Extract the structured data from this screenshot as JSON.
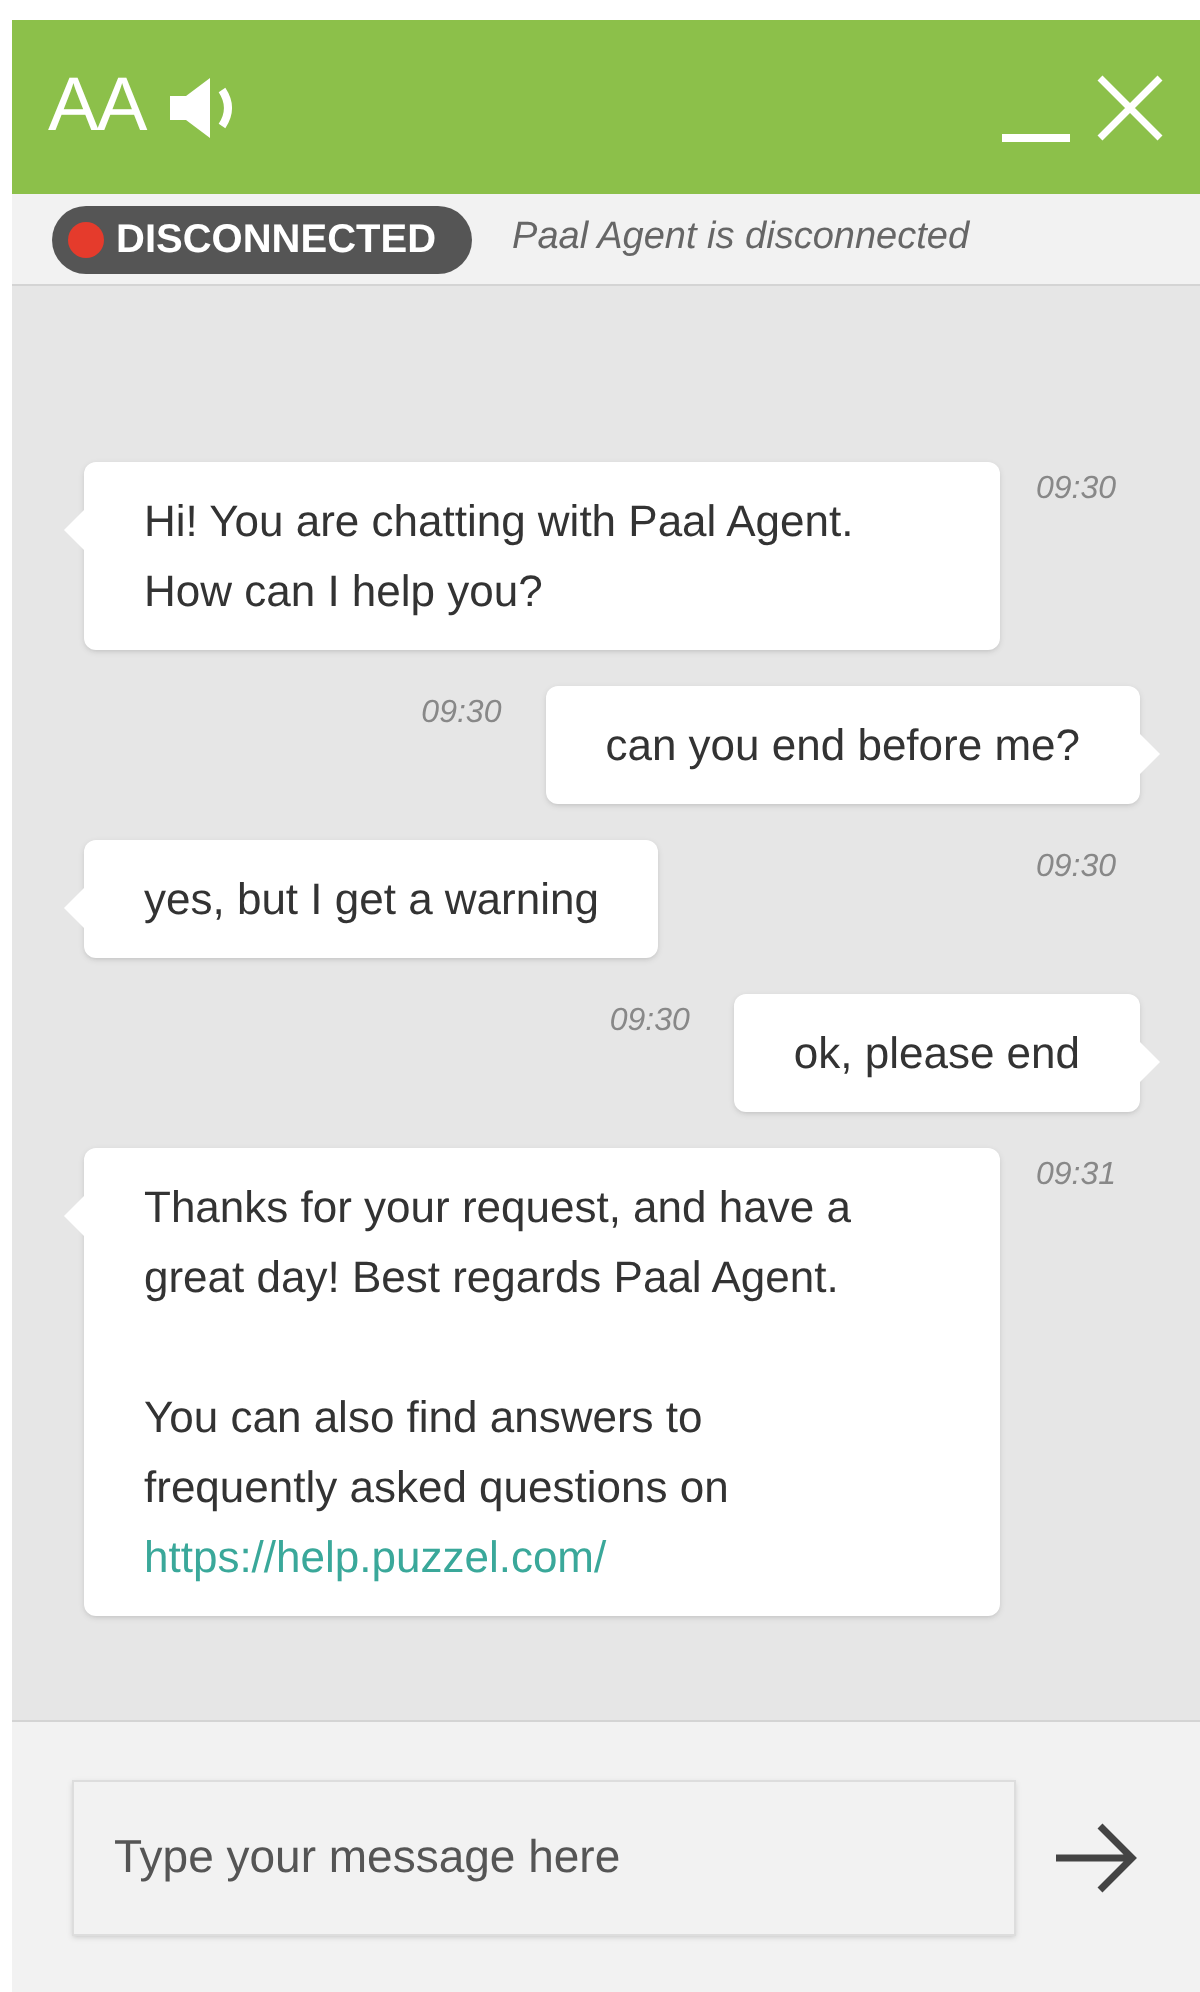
{
  "header": {
    "font_button": "AA"
  },
  "status": {
    "badge": "DISCONNECTED",
    "message": "Paal Agent is disconnected"
  },
  "messages": [
    {
      "kind": "agent",
      "time": "09:30",
      "paragraphs": [
        "Hi! You are chatting with Paal Agent. How can I help you?"
      ]
    },
    {
      "kind": "visitor",
      "time": "09:30",
      "paragraphs": [
        "can you end before me?"
      ]
    },
    {
      "kind": "agent",
      "time": "09:30",
      "paragraphs": [
        "yes, but I get a warning"
      ]
    },
    {
      "kind": "visitor",
      "time": "09:30",
      "paragraphs": [
        "ok, please end"
      ]
    },
    {
      "kind": "agent",
      "time": "09:31",
      "paragraphs": [
        "Thanks for your request, and have a great day! Best regards Paal Agent.",
        "You can also find answers to frequently asked questions on"
      ],
      "link": "https://help.puzzel.com/"
    }
  ],
  "composer": {
    "placeholder": "Type your message here"
  }
}
